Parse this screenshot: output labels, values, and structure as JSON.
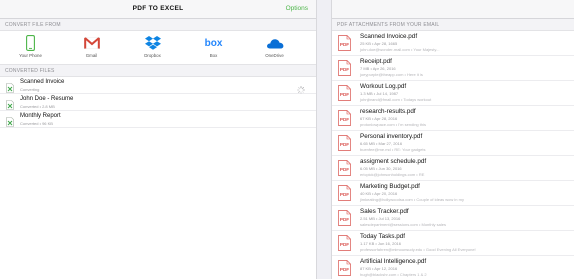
{
  "header": {
    "title": "PDF TO EXCEL",
    "options_label": "Options"
  },
  "left": {
    "convert_from_heading": "CONVERT FILE FROM",
    "sources": [
      {
        "label": "Your Phone",
        "icon": "phone-icon"
      },
      {
        "label": "Gmail",
        "icon": "gmail-icon"
      },
      {
        "label": "Dropbox",
        "icon": "dropbox-icon"
      },
      {
        "label": "Box",
        "icon": "box-icon"
      },
      {
        "label": "OneDrive",
        "icon": "onedrive-icon"
      }
    ],
    "box_logo_text": "box",
    "converted_heading": "CONVERTED FILES",
    "files": [
      {
        "name": "Scanned Invoice",
        "sub": "Converting"
      },
      {
        "name": "John Doe - Resume",
        "sub": "Converted • 2.8 MB"
      },
      {
        "name": "Monthly Report",
        "sub": "Converted • 96 KB"
      }
    ]
  },
  "right": {
    "heading": "PDF ATTACHMENTS FROM YOUR EMAIL",
    "pdf_badge": "PDF",
    "attachments": [
      {
        "name": "Scanned Invoice.pdf",
        "meta": "25 KB • Apr 28, 1665",
        "sender": "john.doe@wonder-mail.com • Your Majesty..."
      },
      {
        "name": "Receipt.pdf",
        "meta": "7 MB • Apr 26, 2016",
        "sender": "joeypurple@theapp.com • Here it is"
      },
      {
        "name": "Workout Log.pdf",
        "meta": "1.3 MB • Jul 14, 1987",
        "sender": "johnjbrand@fmail.com • Todays workout"
      },
      {
        "name": "research-results.pdf",
        "meta": "67 KB • Apr 28, 2016",
        "sender": "protonlowpace.com • I'm sending this"
      },
      {
        "name": "Personal inventory.pdf",
        "meta": "6.65 MB • Mar 27, 2016",
        "sender": "buenfee@me.md • RE: Your gadgets"
      },
      {
        "name": "assigment schedule.pdf",
        "meta": "6.05 MB • Jun 30, 2016",
        "sender": "ericpick@johnsonholdings.com • RE"
      },
      {
        "name": "Marketing Budget.pdf",
        "meta": "40 KB • Apr 20, 2016",
        "sender": "jimkeating@hollywoodsa.com • Couple of ideas wow in my"
      },
      {
        "name": "Sales Tracker.pdf",
        "meta": "2.51 MB • Jul 13, 2016",
        "sender": "salesdepartment@sessions.com • Monthly sales"
      },
      {
        "name": "Today Tasks.pdf",
        "meta": "1.17 KB • Jun 16, 2016",
        "sender": "professorfahren@mimounsudy.edu • Good Evening All Everyone!"
      },
      {
        "name": "Artificial Intelligence.pdf",
        "meta": "87 KB • Apr 12, 2016",
        "sender": "hugh@blackshr.com • Chapters 1 & 2"
      }
    ]
  },
  "colors": {
    "accent": "#4cb548",
    "gmail_red": "#d44638",
    "dropbox_blue": "#0d84e3",
    "box_blue": "#2486fc",
    "onedrive_blue": "#0a6fd6",
    "pdf_red": "#d9534f",
    "excel_green": "#3fa64a"
  }
}
